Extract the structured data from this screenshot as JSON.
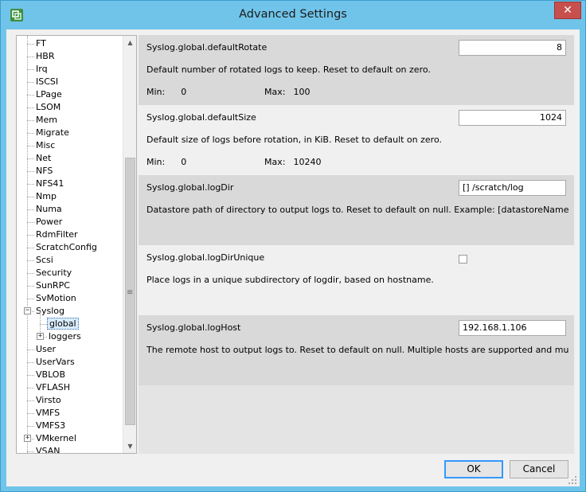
{
  "window": {
    "title": "Advanced Settings",
    "close_symbol": "✕",
    "accent_color": "#70c4ea",
    "close_color": "#c7504f"
  },
  "tree": {
    "items": [
      {
        "label": "FT",
        "level": 0,
        "expander": ""
      },
      {
        "label": "HBR",
        "level": 0,
        "expander": ""
      },
      {
        "label": "Irq",
        "level": 0,
        "expander": ""
      },
      {
        "label": "ISCSI",
        "level": 0,
        "expander": ""
      },
      {
        "label": "LPage",
        "level": 0,
        "expander": ""
      },
      {
        "label": "LSOM",
        "level": 0,
        "expander": ""
      },
      {
        "label": "Mem",
        "level": 0,
        "expander": ""
      },
      {
        "label": "Migrate",
        "level": 0,
        "expander": ""
      },
      {
        "label": "Misc",
        "level": 0,
        "expander": ""
      },
      {
        "label": "Net",
        "level": 0,
        "expander": ""
      },
      {
        "label": "NFS",
        "level": 0,
        "expander": ""
      },
      {
        "label": "NFS41",
        "level": 0,
        "expander": ""
      },
      {
        "label": "Nmp",
        "level": 0,
        "expander": ""
      },
      {
        "label": "Numa",
        "level": 0,
        "expander": ""
      },
      {
        "label": "Power",
        "level": 0,
        "expander": ""
      },
      {
        "label": "RdmFilter",
        "level": 0,
        "expander": ""
      },
      {
        "label": "ScratchConfig",
        "level": 0,
        "expander": ""
      },
      {
        "label": "Scsi",
        "level": 0,
        "expander": ""
      },
      {
        "label": "Security",
        "level": 0,
        "expander": ""
      },
      {
        "label": "SunRPC",
        "level": 0,
        "expander": ""
      },
      {
        "label": "SvMotion",
        "level": 0,
        "expander": ""
      },
      {
        "label": "Syslog",
        "level": 0,
        "expander": "−"
      },
      {
        "label": "global",
        "level": 1,
        "expander": "",
        "selected": true
      },
      {
        "label": "loggers",
        "level": 1,
        "expander": "+"
      },
      {
        "label": "User",
        "level": 0,
        "expander": ""
      },
      {
        "label": "UserVars",
        "level": 0,
        "expander": ""
      },
      {
        "label": "VBLOB",
        "level": 0,
        "expander": ""
      },
      {
        "label": "VFLASH",
        "level": 0,
        "expander": ""
      },
      {
        "label": "Virsto",
        "level": 0,
        "expander": ""
      },
      {
        "label": "VMFS",
        "level": 0,
        "expander": ""
      },
      {
        "label": "VMFS3",
        "level": 0,
        "expander": ""
      },
      {
        "label": "VMkernel",
        "level": 0,
        "expander": "+"
      },
      {
        "label": "VSAN",
        "level": 0,
        "expander": ""
      }
    ],
    "scroll_up": "▲",
    "scroll_down": "▼",
    "grip": "≡"
  },
  "settings": [
    {
      "name": "Syslog.global.defaultRotate",
      "description": "Default number of rotated logs to keep. Reset to default on zero.",
      "min_label": "Min:",
      "min": "0",
      "max_label": "Max:",
      "max": "100",
      "value": "8",
      "kind": "number"
    },
    {
      "name": "Syslog.global.defaultSize",
      "description": "Default size of logs before rotation, in KiB. Reset to default on zero.",
      "min_label": "Min:",
      "min": "0",
      "max_label": "Max:",
      "max": "10240",
      "value": "1024",
      "kind": "number"
    },
    {
      "name": "Syslog.global.logDir",
      "description": "Datastore path of directory to output logs to. Reset to default on null. Example: [datastoreName]/logdir",
      "value": "[] /scratch/log",
      "kind": "text"
    },
    {
      "name": "Syslog.global.logDirUnique",
      "description": "Place logs in a unique subdirectory of logdir, based on hostname.",
      "checked": false,
      "kind": "checkbox"
    },
    {
      "name": "Syslog.global.logHost",
      "description": "The remote host to output logs to. Reset to default on null. Multiple hosts are supported and must be s...",
      "value": "192.168.1.106",
      "kind": "text"
    }
  ],
  "buttons": {
    "ok": "OK",
    "cancel": "Cancel"
  }
}
